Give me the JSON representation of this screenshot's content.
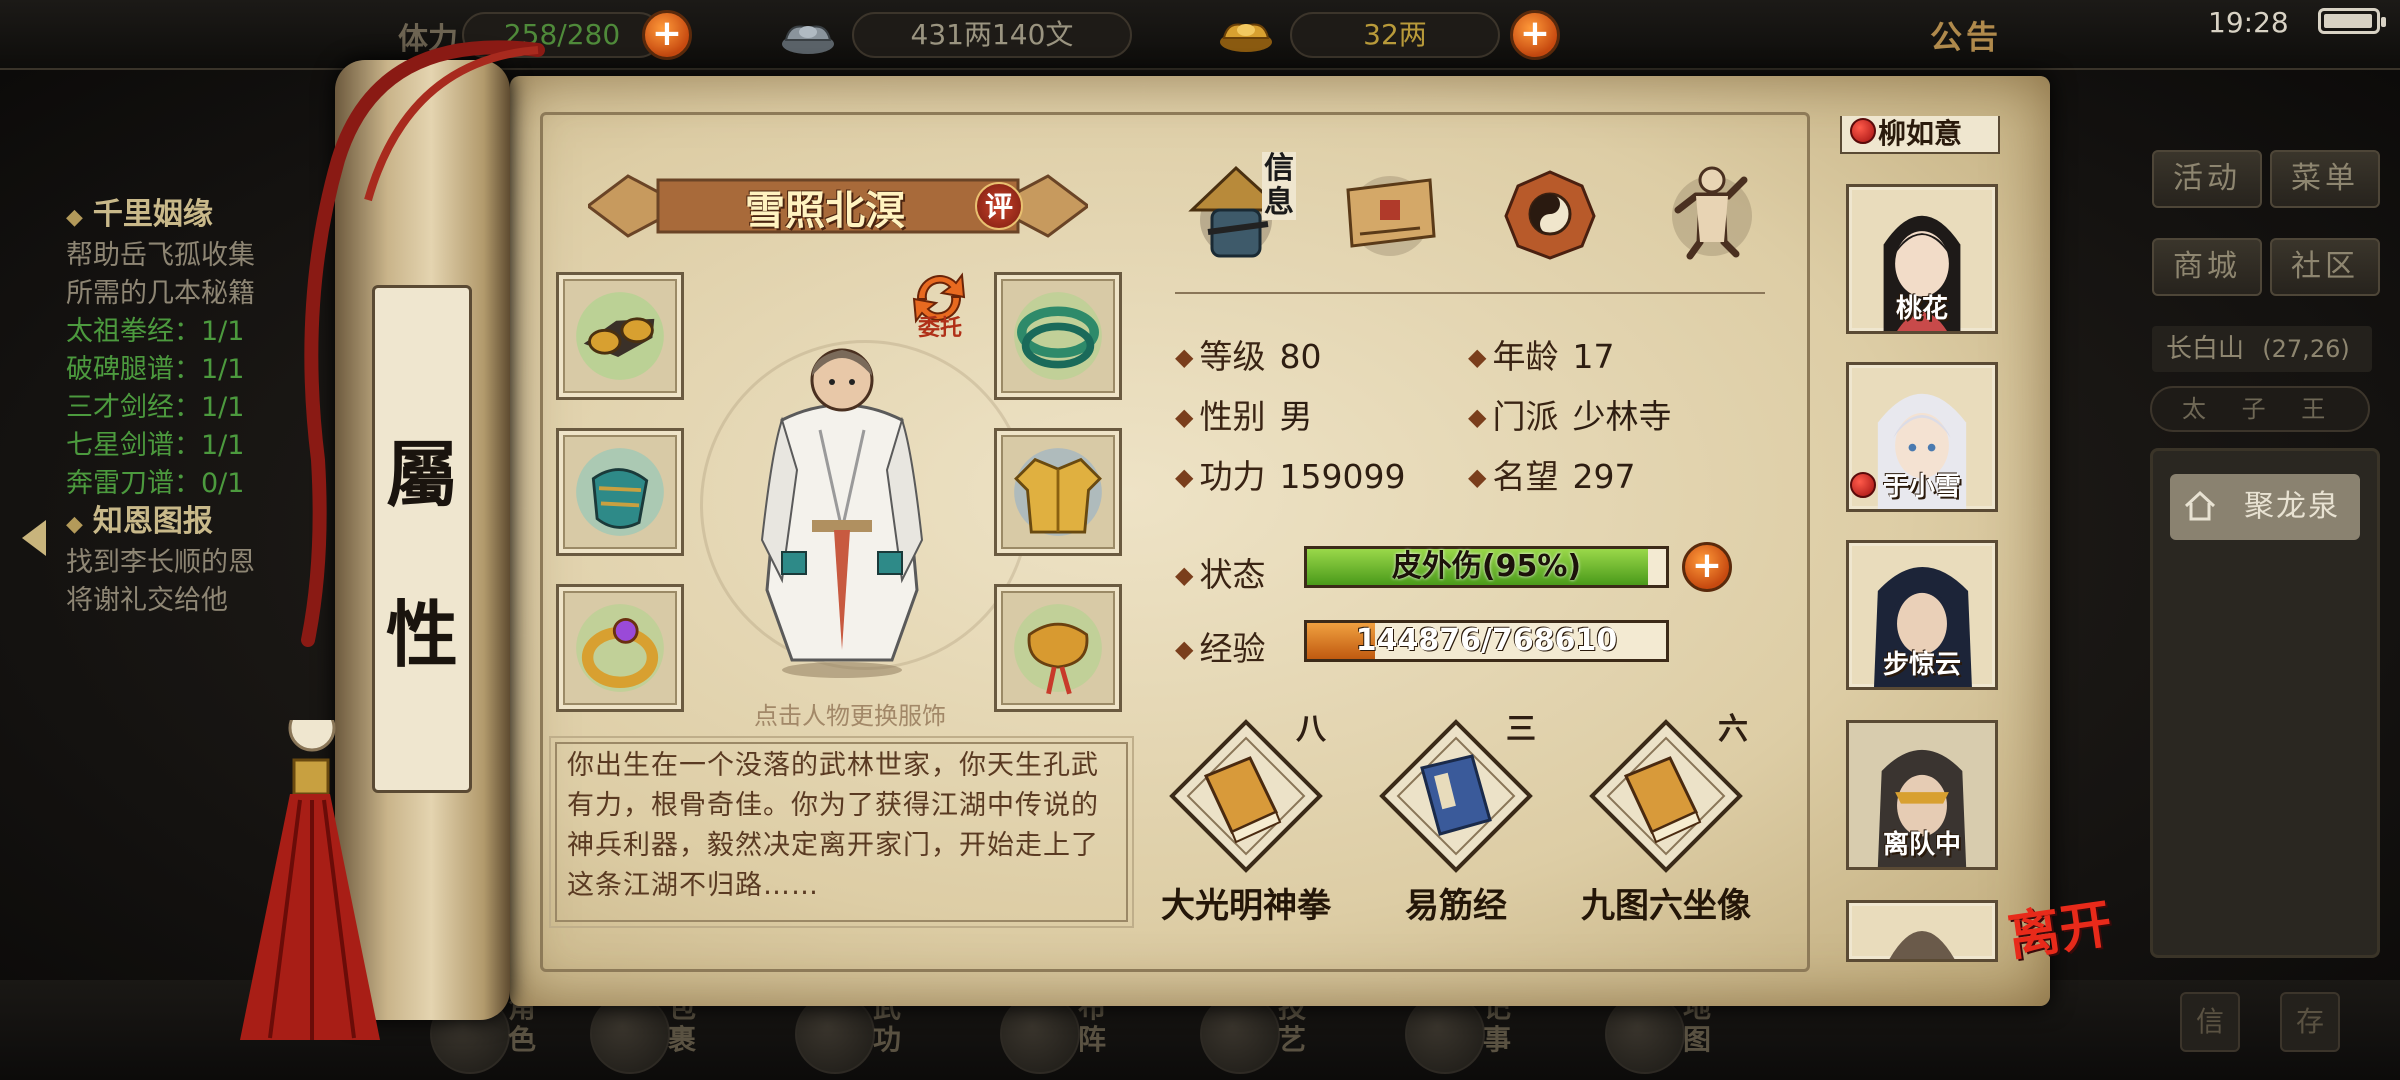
{
  "topbar": {
    "stamina_label": "体力",
    "stamina_value": "258/280",
    "money_value": "431两140文",
    "gold_value": "32两",
    "notice_label": "公告",
    "time": "19:28"
  },
  "quests": [
    {
      "title": "千里姻缘",
      "desc": [
        "帮助岳飞孤收集",
        "所需的几本秘籍"
      ],
      "items": [
        {
          "text": "太祖拳经：1/1",
          "done": true
        },
        {
          "text": "破碑腿谱：1/1",
          "done": true
        },
        {
          "text": "三才剑经：1/1",
          "done": true
        },
        {
          "text": "七星剑谱：1/1",
          "done": true
        },
        {
          "text": "奔雷刀谱：0/1",
          "done": false
        }
      ]
    },
    {
      "title": "知恩图报",
      "desc": [
        "找到李长顺的恩",
        "将谢礼交给他"
      ],
      "items": []
    }
  ],
  "scroll": {
    "title_top": "屬",
    "title_bottom": "性"
  },
  "character": {
    "name": "雪照北溟",
    "rate_label": "评",
    "delegate_label": "委托",
    "change_outfit_hint": "点击人物更换服饰",
    "bio": "你出生在一个没落的武林世家，你天生孔武有力，根骨奇佳。你为了获得江湖中传说的神兵利器，毅然决定离开家门，开始走上了这条江湖不归路……"
  },
  "tabs": {
    "info_label": "信息"
  },
  "stats": {
    "level": {
      "label": "等级",
      "value": "80"
    },
    "age": {
      "label": "年龄",
      "value": "17"
    },
    "gender": {
      "label": "性别",
      "value": "男"
    },
    "sect": {
      "label": "门派",
      "value": "少林寺"
    },
    "power": {
      "label": "功力",
      "value": "159099"
    },
    "fame": {
      "label": "名望",
      "value": "297"
    },
    "status": {
      "label": "状态",
      "text": "皮外伤(95%)",
      "fraction": 0.95
    },
    "exp": {
      "label": "经验",
      "text": "144876/768610",
      "fraction": 0.1885
    }
  },
  "skills": [
    {
      "name": "大光明神拳",
      "level": "八"
    },
    {
      "name": "易筋经",
      "level": "三"
    },
    {
      "name": "九图六坐像",
      "level": "六"
    }
  ],
  "party": [
    {
      "name": "柳如意",
      "alert": true
    },
    {
      "name": "桃花",
      "alert": false
    },
    {
      "name": "于小雪",
      "alert": true
    },
    {
      "name": "步惊云",
      "alert": false
    },
    {
      "name": "离队中",
      "alert": false
    }
  ],
  "leave_label": "离开",
  "right_menu": {
    "activity": "活动",
    "menu": "菜单",
    "shop": "商城",
    "community": "社区",
    "location_name": "长白山",
    "location_coords": "(27,26)",
    "compass": "太 子 王",
    "spring_label": "聚龙泉"
  },
  "bottom_nav": [
    "角色",
    "包裹",
    "武功",
    "布阵",
    "技艺",
    "记事",
    "地图"
  ],
  "bottom_buttons": [
    "信",
    "存"
  ]
}
